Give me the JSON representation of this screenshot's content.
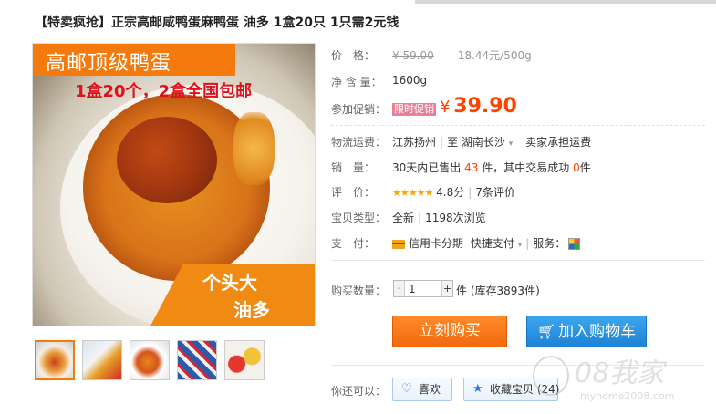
{
  "title": "【特卖疯抢】正宗高邮咸鸭蛋麻鸭蛋 油多 1盒20只 1只需2元钱",
  "image": {
    "ribbon_text": "高邮顶级鸭蛋",
    "promo_text": "1盒20个，2盒全国包邮",
    "badge_line1": "个头大",
    "badge_line2": "油多"
  },
  "thumbnails": [
    "thumb-1",
    "thumb-2",
    "thumb-3",
    "thumb-4",
    "thumb-5"
  ],
  "price": {
    "label": "价　格：",
    "old": "¥ 59.00",
    "unit": "18.44元/500g"
  },
  "weight": {
    "label": "净 含 量：",
    "value": "1600g"
  },
  "promo": {
    "label": "参加促销：",
    "tag": "限时促销",
    "yen": "¥",
    "price": "39.90"
  },
  "shipping": {
    "label": "物流运费：",
    "from": "江苏扬州",
    "to_prefix": "至",
    "to": "湖南长沙",
    "fee": "卖家承担运费"
  },
  "sales": {
    "label": "销　量：",
    "prefix": "30天内已售出",
    "sold": "43",
    "mid": "件，其中交易成功",
    "success": "0",
    "suffix": "件"
  },
  "rating": {
    "label": "评　价：",
    "stars": "★★★★★",
    "score": "4.8分",
    "count": "7条评价"
  },
  "type": {
    "label": "宝贝类型：",
    "condition": "全新",
    "views": "1198次浏览"
  },
  "payment": {
    "label": "支　付：",
    "card": "信用卡分期",
    "quick": "快捷支付",
    "service_label": "服务："
  },
  "quantity": {
    "label": "购买数量：",
    "value": "1",
    "minus": "-",
    "plus": "+",
    "unit": "件",
    "stock": "(库存3893件)"
  },
  "buttons": {
    "buy": "立刻购买",
    "cart": "加入购物车"
  },
  "extra": {
    "label": "你还可以：",
    "like": "喜欢",
    "fav": "收藏宝贝 (24)"
  },
  "watermark": {
    "line1": "08我家",
    "line2": "myhome2008.com"
  },
  "colors": {
    "price_red": "#ff4400",
    "buy_orange": "#f26a0c",
    "cart_blue": "#1c83d6"
  }
}
